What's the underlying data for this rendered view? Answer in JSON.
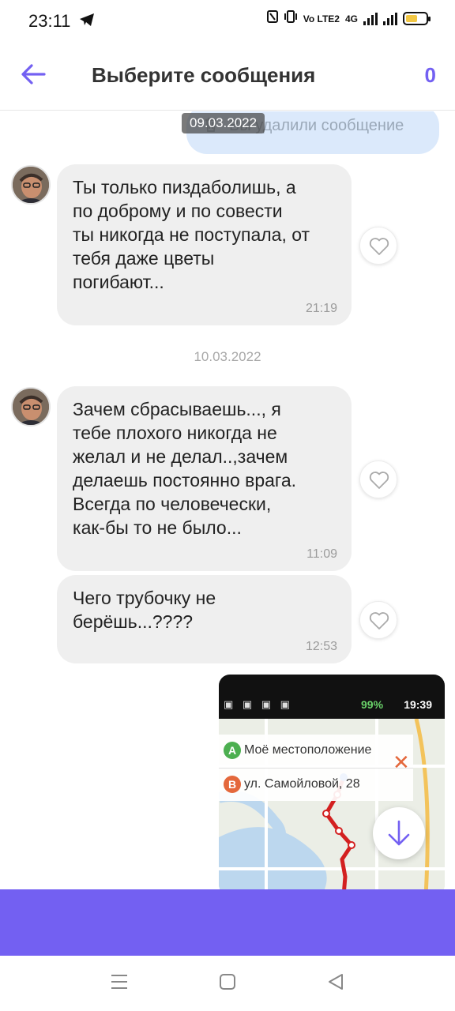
{
  "status_bar": {
    "time": "23:11",
    "network_label": "Vo LTE2",
    "network_type": "4G",
    "battery_level_fraction": 0.6
  },
  "header": {
    "title": "Выберите сообщения",
    "selected_count": "0"
  },
  "messages": {
    "deleted_outgoing": "Вы удалили сообщение",
    "date_1": "09.03.2022",
    "date_2": "10.03.2022",
    "incoming": [
      {
        "text": "Ты только пиздаболишь, а\nпо доброму и по совести\nты никогда не поступала, от\nтебя даже цветы\nпогибают...",
        "time": "21:19"
      },
      {
        "text": "Зачем сбрасываешь..., я\nтебе плохого никогда не\nжелал и не делал..,зачем\nделаешь постоянно врага.\nВсегда по человечески,\nкак-бы то не было...",
        "time": "11:09"
      },
      {
        "text": "Чего трубочку не\nберёшь...????",
        "time": "12:53"
      }
    ]
  },
  "media_preview": {
    "status_battery": "99%",
    "status_time": "19:39",
    "route_from_marker": "A",
    "route_from": "Моё местоположение",
    "route_to_marker": "B",
    "route_to": "ул. Самойловой, 28",
    "close_symbol": "✕"
  },
  "colors": {
    "accent": "#7360f2",
    "bubble": "#efefef",
    "outgoing_bubble": "#dbe9fb"
  }
}
